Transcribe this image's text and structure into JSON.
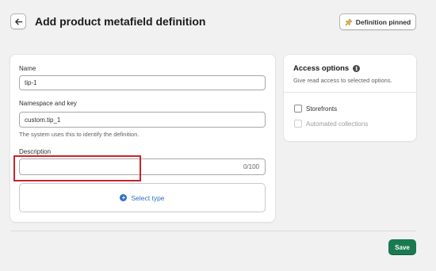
{
  "header": {
    "title": "Add product metafield definition",
    "pin_label": "Definition pinned"
  },
  "form": {
    "name_label": "Name",
    "name_value": "tip-1",
    "namespace_label": "Namespace and key",
    "namespace_value": "custom.tip_1",
    "namespace_help": "The system uses this to identify the definition.",
    "description_label": "Description",
    "description_value": "",
    "description_counter": "0/100",
    "select_type_label": "Select type"
  },
  "access": {
    "title": "Access options",
    "subtitle": "Give read access to selected options.",
    "options": [
      {
        "label": "Storefronts",
        "checked": false,
        "disabled": false
      },
      {
        "label": "Automated collections",
        "checked": false,
        "disabled": true
      }
    ]
  },
  "footer": {
    "save_label": "Save"
  },
  "colors": {
    "primary_button": "#1a7a4f",
    "link": "#2c6ecb",
    "highlight": "#c8232c"
  }
}
